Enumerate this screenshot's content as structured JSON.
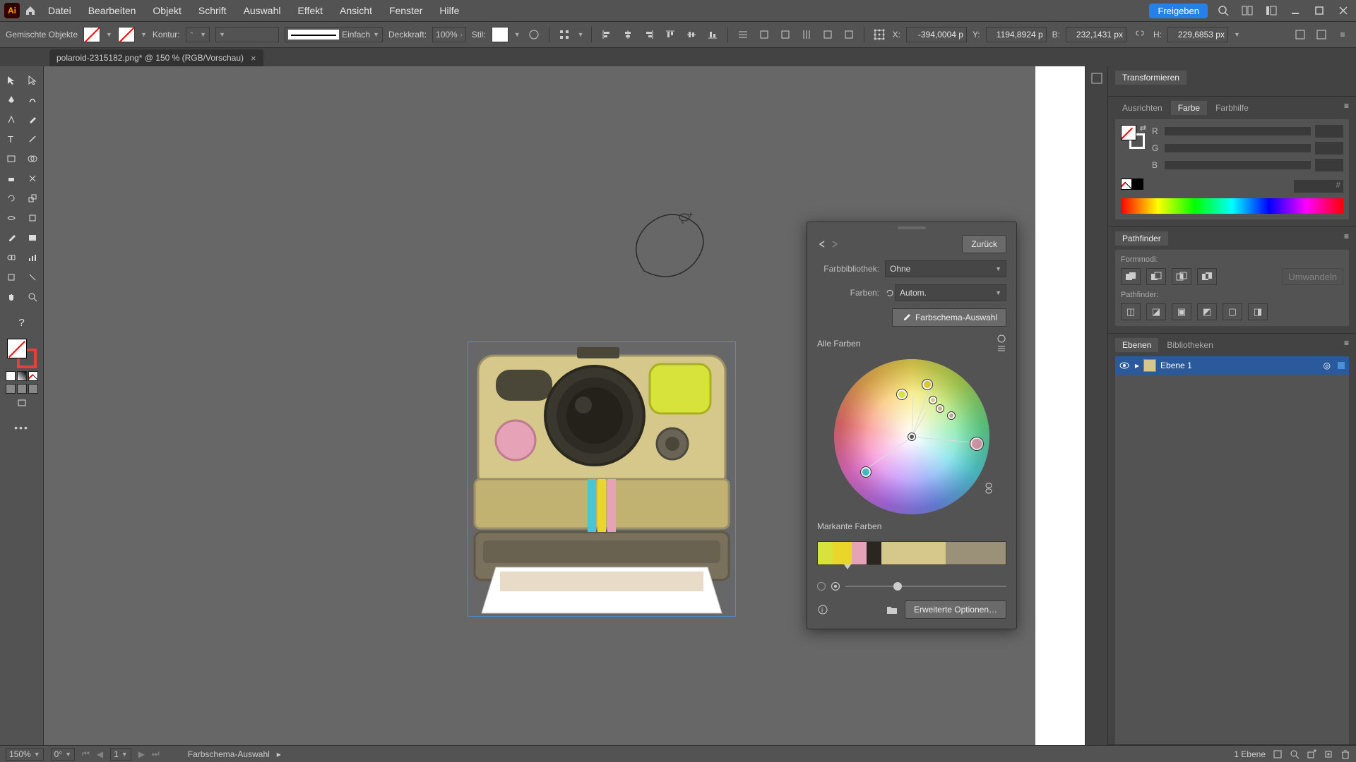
{
  "app": {
    "logo_text": "Ai"
  },
  "menus": [
    "Datei",
    "Bearbeiten",
    "Objekt",
    "Schrift",
    "Auswahl",
    "Effekt",
    "Ansicht",
    "Fenster",
    "Hilfe"
  ],
  "menubar": {
    "share_label": "Freigeben"
  },
  "controlbar": {
    "selection_label": "Gemischte Objekte",
    "stroke_label": "Kontur:",
    "stroke_weight": "",
    "stroke_style_label": "Einfach",
    "opacity_label": "Deckkraft:",
    "opacity_value": "100%",
    "style_label": "Stil:",
    "x_label": "X:",
    "x_value": "-394,0004 p",
    "y_label": "Y:",
    "y_value": "1194,8924 p",
    "w_label": "B:",
    "w_value": "232,1431 px",
    "h_label": "H:",
    "h_value": "229,6853 px"
  },
  "tab": {
    "title": "polaroid-2315182.png* @ 150 % (RGB/Vorschau)"
  },
  "recolor": {
    "back_label": "Zurück",
    "library_label": "Farbbibliothek:",
    "library_value": "Ohne",
    "colors_label": "Farben:",
    "colors_value": "Autom.",
    "picker_button": "Farbschema-Auswahl",
    "all_colors_label": "Alle Farben",
    "prominent_label": "Markante Farben",
    "extended_label": "Erweiterte Optionen…",
    "swatch_colors": [
      "#d7e23a",
      "#e8d62a",
      "#e6a3b8",
      "#2b2620",
      "#d6c88a",
      "#9a9178"
    ],
    "swatch_widths": [
      8,
      10,
      8,
      8,
      34,
      32
    ]
  },
  "right": {
    "transform_tab": "Transformieren",
    "align_tab": "Ausrichten",
    "color_tab": "Farbe",
    "guide_tab": "Farbhilfe",
    "rgb_labels": [
      "R",
      "G",
      "B"
    ],
    "pathfinder_tab": "Pathfinder",
    "shapemode_label": "Formmodi:",
    "pathfinder_label": "Pathfinder:",
    "expand_label": "Umwandeln",
    "layers_tab": "Ebenen",
    "libraries_tab": "Bibliotheken",
    "layer1_name": "Ebene 1"
  },
  "status": {
    "zoom": "150%",
    "rotation": "0°",
    "artboard_num": "1",
    "tool_status": "Farbschema-Auswahl",
    "layer_count": "1 Ebene"
  },
  "artwork": {
    "colors": {
      "body": "#d6c88a",
      "body_dark": "#c2b272",
      "top_plate": "#4a4638",
      "flash": "#d7e23a",
      "shutter": "#e6a3b8",
      "small_knob": "#6a6456",
      "slot": "#7a715c",
      "photo": "#ffffff",
      "photo_inner": "#e8dbc7",
      "stripe1": "#46c6d9",
      "stripe2": "#e8d62a",
      "stripe3": "#e6a3b8"
    }
  }
}
